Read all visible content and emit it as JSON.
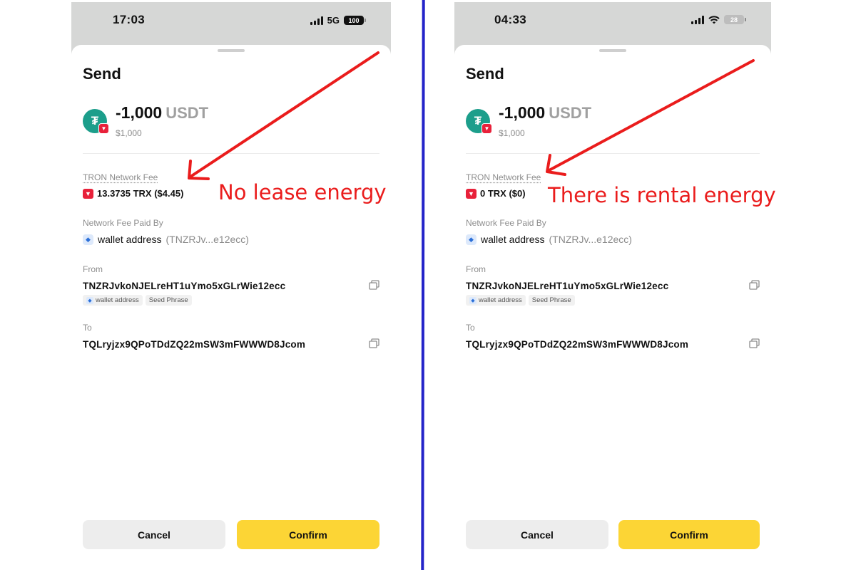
{
  "left": {
    "time": "17:03",
    "network": "5G",
    "battery": "100",
    "title": "Send",
    "coin_symbol": "₮",
    "amount": "-1,000",
    "currency": "USDT",
    "fiat": "$1,000",
    "fee_label": "TRON Network Fee",
    "fee_value": "13.3735 TRX ($4.45)",
    "paid_by_label": "Network Fee Paid By",
    "payer_name": "wallet address",
    "payer_address": "(TNZRJv...e12ecc)",
    "from_label": "From",
    "from_address": "TNZRJvkoNJELreHT1uYmo5xGLrWie12ecc",
    "tag_wallet": "wallet address",
    "tag_seed": "Seed Phrase",
    "to_label": "To",
    "to_address": "TQLryjzx9QPoTDdZQ22mSW3mFWWWD8Jcom",
    "cancel": "Cancel",
    "confirm": "Confirm",
    "annotation": "No lease energy"
  },
  "right": {
    "time": "04:33",
    "battery": "28",
    "title": "Send",
    "coin_symbol": "₮",
    "amount": "-1,000",
    "currency": "USDT",
    "fiat": "$1,000",
    "fee_label": "TRON Network Fee",
    "fee_value": "0 TRX ($0)",
    "paid_by_label": "Network Fee Paid By",
    "payer_name": "wallet address",
    "payer_address": "(TNZRJv...e12ecc)",
    "from_label": "From",
    "from_address": "TNZRJvkoNJELreHT1uYmo5xGLrWie12ecc",
    "tag_wallet": "wallet address",
    "tag_seed": "Seed Phrase",
    "to_label": "To",
    "to_address": "TQLryjzx9QPoTDdZQ22mSW3mFWWWD8Jcom",
    "cancel": "Cancel",
    "confirm": "Confirm",
    "annotation": "There is rental energy"
  },
  "colors": {
    "confirm": "#fcd535",
    "annotation": "#ea1c1c",
    "divider_line": "#2424c9",
    "tether": "#1c9e8b",
    "tron": "#e8213a"
  },
  "icons": [
    "signal-icon",
    "wifi-icon",
    "battery-icon",
    "tether-icon",
    "tron-icon",
    "wallet-icon",
    "copy-icon",
    "arrow-annotation"
  ]
}
